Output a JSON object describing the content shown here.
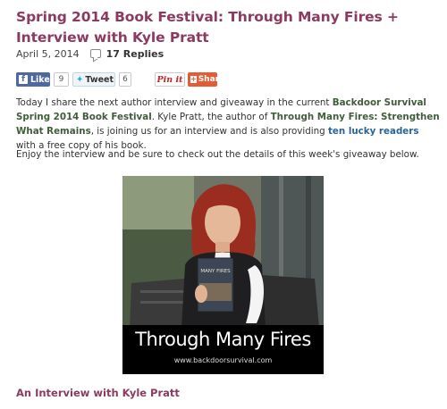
{
  "post": {
    "title": "Spring 2014 Book Festival: Through Many Fires + Interview with Kyle Pratt",
    "date": "April 5, 2014",
    "replies": "17 Replies"
  },
  "share": {
    "like_label": "Like",
    "like_count": "9",
    "tweet_label": "Tweet",
    "tweet_count": "6",
    "pin_label": "Pin it",
    "share_label": "Share"
  },
  "intro": {
    "t1": "Today I share the next author interview and giveaway in the current ",
    "festival_link": "Backdoor Survival Spring 2014 Book Festival",
    "t2": ".  Kyle Pratt, the author of ",
    "book_link": "Through Many Fires: Strengthen What Remains",
    "t3": ", is joining us for an interview and is also providing ",
    "readers_link": "ten lucky readers",
    "t4": " with a free copy of his book."
  },
  "enjoy": "Enjoy the interview and be sure to check out the details of this week's giveaway below.",
  "image": {
    "book_cover_text": "MANY FIRES",
    "caption_title": "Through Many Fires",
    "caption_url": "www.backdoorsurvival.com"
  },
  "section_heading": "An Interview with Kyle Pratt"
}
